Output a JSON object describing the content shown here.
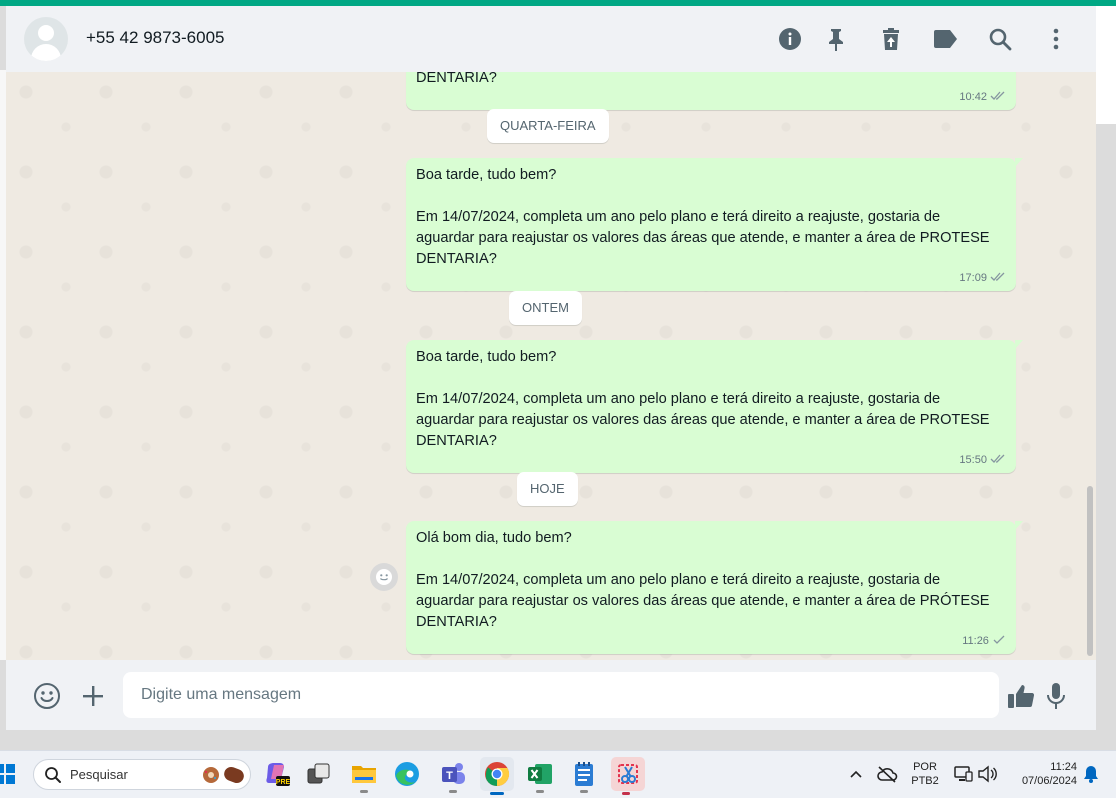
{
  "header": {
    "contact_name": "+55 42 9873-6005",
    "icons": [
      "info-icon",
      "pin-icon",
      "delete-icon",
      "label-icon",
      "search-icon",
      "more-options-icon"
    ]
  },
  "messages": [
    {
      "lines": [
        "DENTARIA?"
      ],
      "time": "10:42",
      "status": "read"
    },
    {
      "date": "QUARTA-FEIRA"
    },
    {
      "lines": [
        "Boa tarde, tudo bem?",
        "",
        "Em 14/07/2024, completa um ano pelo plano e terá direito a reajuste, gostaria de",
        "aguardar para reajustar os valores das áreas que atende, e manter a área de PROTESE",
        "DENTARIA?"
      ],
      "time": "17:09",
      "status": "read"
    },
    {
      "date": "ONTEM"
    },
    {
      "lines": [
        "Boa tarde, tudo bem?",
        "",
        "Em 14/07/2024, completa um ano pelo plano e terá direito a reajuste, gostaria de",
        "aguardar para reajustar os valores das áreas que atende, e manter a área de PROTESE",
        "DENTARIA?"
      ],
      "time": "15:50",
      "status": "read"
    },
    {
      "date": "HOJE"
    },
    {
      "lines": [
        "Olá bom dia, tudo bem?",
        "",
        "Em 14/07/2024, completa um ano pelo plano e terá direito a reajuste, gostaria de",
        "aguardar para reajustar os valores das áreas que atende, e manter a área de PRÓTESE",
        "DENTARIA?"
      ],
      "time": "11:26",
      "status": "sent"
    }
  ],
  "chat": {
    "m0": {
      "l1": "DENTARIA?",
      "time": "10:42"
    },
    "d1": "QUARTA-FEIRA",
    "m1": {
      "l1": "Boa tarde, tudo bem?",
      "l2": "Em 14/07/2024, completa um ano pelo plano e terá direito a reajuste, gostaria de",
      "l3": "aguardar para reajustar os valores das áreas que atende, e manter a área de PROTESE",
      "l4": "DENTARIA?",
      "time": "17:09"
    },
    "d2": "ONTEM",
    "m2": {
      "l1": "Boa tarde, tudo bem?",
      "l2": "Em 14/07/2024, completa um ano pelo plano e terá direito a reajuste, gostaria de",
      "l3": "aguardar para reajustar os valores das áreas que atende, e manter a área de PROTESE",
      "l4": "DENTARIA?",
      "time": "15:50"
    },
    "d3": "HOJE",
    "m3": {
      "l1": "Olá bom dia, tudo bem?",
      "l2": "Em 14/07/2024, completa um ano pelo plano e terá direito a reajuste, gostaria de",
      "l3": "aguardar para reajustar os valores das áreas que atende, e manter a área de PRÓTESE",
      "l4": "DENTARIA?",
      "time": "11:26"
    }
  },
  "composer": {
    "placeholder": "Digite uma mensagem",
    "icons": [
      "emoji-icon",
      "attach-plus-icon",
      "thumbs-up-icon",
      "microphone-icon"
    ]
  },
  "taskbar": {
    "search_placeholder": "Pesquisar",
    "apps": [
      "windows-start-icon",
      "copilot-pre-icon",
      "task-view-icon",
      "file-explorer-icon",
      "edge-icon",
      "teams-icon",
      "chrome-icon",
      "excel-icon",
      "notepad-icon",
      "snipping-tool-icon"
    ],
    "language_line1": "POR",
    "language_line2": "PTB2",
    "clock_time": "11:24",
    "clock_date": "07/06/2024"
  },
  "colors": {
    "accent_green": "#00a884",
    "outgoing_bubble": "#d9fdd3",
    "read_tick": "#53bdeb",
    "chat_background": "#efeae2"
  }
}
